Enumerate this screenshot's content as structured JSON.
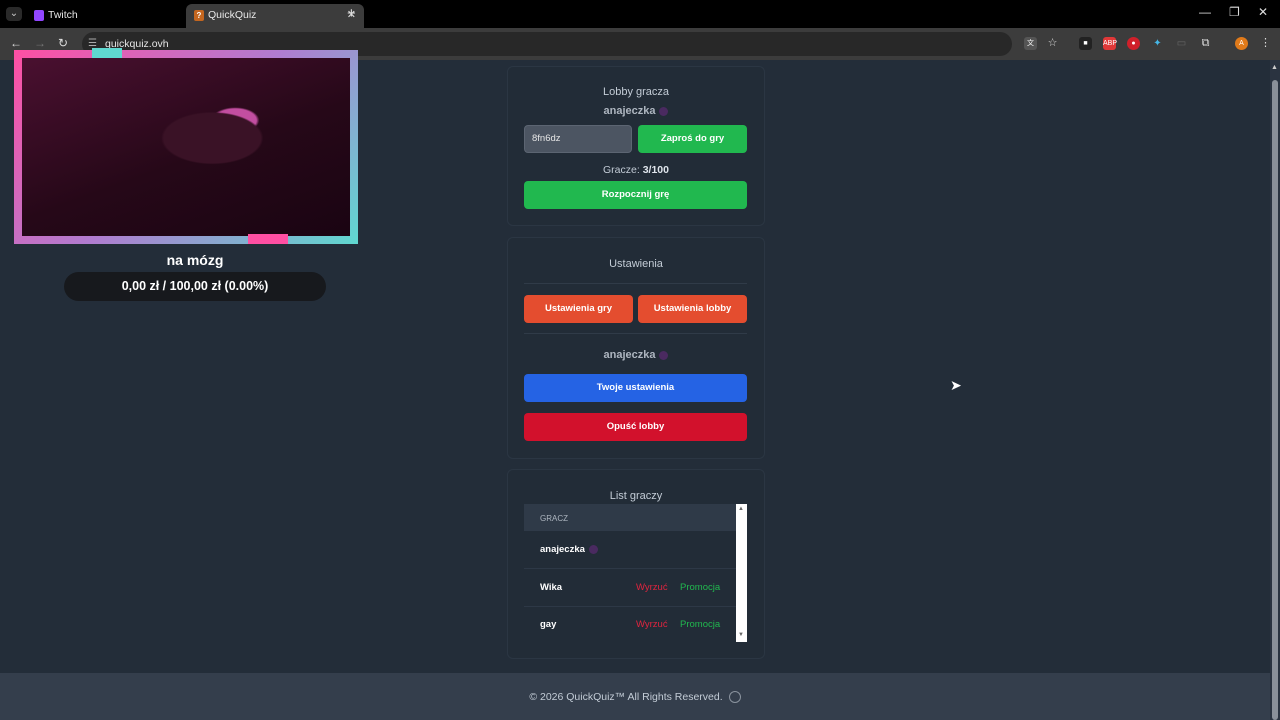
{
  "browser": {
    "tabs": [
      {
        "label": "Twitch",
        "active": false
      },
      {
        "label": "QuickQuiz",
        "active": true
      }
    ],
    "url": "quickquiz.ovh"
  },
  "stream": {
    "title": "na mózg",
    "donation": "0,00 zł / 100,00 zł (0.00%)"
  },
  "lobby": {
    "title": "Lobby gracza",
    "owner": "anajeczka",
    "code": "8fn6dz",
    "invite_label": "Zaproś do gry",
    "players_label": "Gracze:",
    "players_value": "3/100",
    "start_label": "Rozpocznij grę"
  },
  "settings": {
    "title": "Ustawienia",
    "game_settings_label": "Ustawienia gry",
    "lobby_settings_label": "Ustawienia lobby",
    "user": "anajeczka",
    "your_settings_label": "Twoje ustawienia",
    "leave_label": "Opuść lobby"
  },
  "players": {
    "title": "List graczy",
    "column": "GRACZ",
    "rows": [
      {
        "name": "anajeczka"
      },
      {
        "name": "Wika",
        "kick": "Wyrzuć",
        "promote": "Promocja"
      },
      {
        "name": "gay",
        "kick": "Wyrzuć",
        "promote": "Promocja"
      }
    ]
  },
  "footer": {
    "text": "© 2026  QuickQuiz™ All Rights Reserved."
  },
  "colors": {
    "background": "#232d39",
    "green": "#21b84f",
    "orange": "#e44d2f",
    "blue": "#2563e4",
    "red": "#d2112c"
  }
}
